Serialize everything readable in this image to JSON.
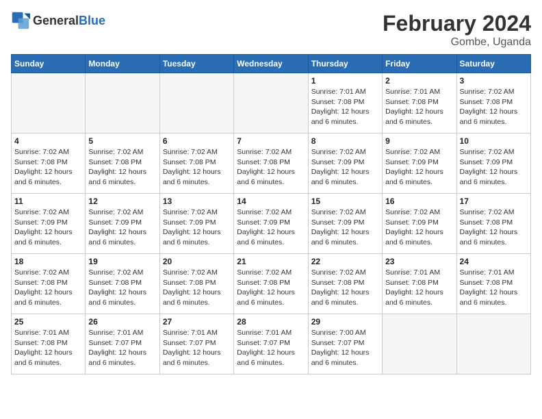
{
  "header": {
    "logo_general": "General",
    "logo_blue": "Blue",
    "month_title": "February 2024",
    "location": "Gombe, Uganda"
  },
  "weekdays": [
    "Sunday",
    "Monday",
    "Tuesday",
    "Wednesday",
    "Thursday",
    "Friday",
    "Saturday"
  ],
  "weeks": [
    [
      {
        "day": "",
        "info": ""
      },
      {
        "day": "",
        "info": ""
      },
      {
        "day": "",
        "info": ""
      },
      {
        "day": "",
        "info": ""
      },
      {
        "day": "1",
        "info": "Sunrise: 7:01 AM\nSunset: 7:08 PM\nDaylight: 12 hours\nand 6 minutes."
      },
      {
        "day": "2",
        "info": "Sunrise: 7:01 AM\nSunset: 7:08 PM\nDaylight: 12 hours\nand 6 minutes."
      },
      {
        "day": "3",
        "info": "Sunrise: 7:02 AM\nSunset: 7:08 PM\nDaylight: 12 hours\nand 6 minutes."
      }
    ],
    [
      {
        "day": "4",
        "info": "Sunrise: 7:02 AM\nSunset: 7:08 PM\nDaylight: 12 hours\nand 6 minutes."
      },
      {
        "day": "5",
        "info": "Sunrise: 7:02 AM\nSunset: 7:08 PM\nDaylight: 12 hours\nand 6 minutes."
      },
      {
        "day": "6",
        "info": "Sunrise: 7:02 AM\nSunset: 7:08 PM\nDaylight: 12 hours\nand 6 minutes."
      },
      {
        "day": "7",
        "info": "Sunrise: 7:02 AM\nSunset: 7:08 PM\nDaylight: 12 hours\nand 6 minutes."
      },
      {
        "day": "8",
        "info": "Sunrise: 7:02 AM\nSunset: 7:09 PM\nDaylight: 12 hours\nand 6 minutes."
      },
      {
        "day": "9",
        "info": "Sunrise: 7:02 AM\nSunset: 7:09 PM\nDaylight: 12 hours\nand 6 minutes."
      },
      {
        "day": "10",
        "info": "Sunrise: 7:02 AM\nSunset: 7:09 PM\nDaylight: 12 hours\nand 6 minutes."
      }
    ],
    [
      {
        "day": "11",
        "info": "Sunrise: 7:02 AM\nSunset: 7:09 PM\nDaylight: 12 hours\nand 6 minutes."
      },
      {
        "day": "12",
        "info": "Sunrise: 7:02 AM\nSunset: 7:09 PM\nDaylight: 12 hours\nand 6 minutes."
      },
      {
        "day": "13",
        "info": "Sunrise: 7:02 AM\nSunset: 7:09 PM\nDaylight: 12 hours\nand 6 minutes."
      },
      {
        "day": "14",
        "info": "Sunrise: 7:02 AM\nSunset: 7:09 PM\nDaylight: 12 hours\nand 6 minutes."
      },
      {
        "day": "15",
        "info": "Sunrise: 7:02 AM\nSunset: 7:09 PM\nDaylight: 12 hours\nand 6 minutes."
      },
      {
        "day": "16",
        "info": "Sunrise: 7:02 AM\nSunset: 7:09 PM\nDaylight: 12 hours\nand 6 minutes."
      },
      {
        "day": "17",
        "info": "Sunrise: 7:02 AM\nSunset: 7:08 PM\nDaylight: 12 hours\nand 6 minutes."
      }
    ],
    [
      {
        "day": "18",
        "info": "Sunrise: 7:02 AM\nSunset: 7:08 PM\nDaylight: 12 hours\nand 6 minutes."
      },
      {
        "day": "19",
        "info": "Sunrise: 7:02 AM\nSunset: 7:08 PM\nDaylight: 12 hours\nand 6 minutes."
      },
      {
        "day": "20",
        "info": "Sunrise: 7:02 AM\nSunset: 7:08 PM\nDaylight: 12 hours\nand 6 minutes."
      },
      {
        "day": "21",
        "info": "Sunrise: 7:02 AM\nSunset: 7:08 PM\nDaylight: 12 hours\nand 6 minutes."
      },
      {
        "day": "22",
        "info": "Sunrise: 7:02 AM\nSunset: 7:08 PM\nDaylight: 12 hours\nand 6 minutes."
      },
      {
        "day": "23",
        "info": "Sunrise: 7:01 AM\nSunset: 7:08 PM\nDaylight: 12 hours\nand 6 minutes."
      },
      {
        "day": "24",
        "info": "Sunrise: 7:01 AM\nSunset: 7:08 PM\nDaylight: 12 hours\nand 6 minutes."
      }
    ],
    [
      {
        "day": "25",
        "info": "Sunrise: 7:01 AM\nSunset: 7:08 PM\nDaylight: 12 hours\nand 6 minutes."
      },
      {
        "day": "26",
        "info": "Sunrise: 7:01 AM\nSunset: 7:07 PM\nDaylight: 12 hours\nand 6 minutes."
      },
      {
        "day": "27",
        "info": "Sunrise: 7:01 AM\nSunset: 7:07 PM\nDaylight: 12 hours\nand 6 minutes."
      },
      {
        "day": "28",
        "info": "Sunrise: 7:01 AM\nSunset: 7:07 PM\nDaylight: 12 hours\nand 6 minutes."
      },
      {
        "day": "29",
        "info": "Sunrise: 7:00 AM\nSunset: 7:07 PM\nDaylight: 12 hours\nand 6 minutes."
      },
      {
        "day": "",
        "info": ""
      },
      {
        "day": "",
        "info": ""
      }
    ]
  ]
}
